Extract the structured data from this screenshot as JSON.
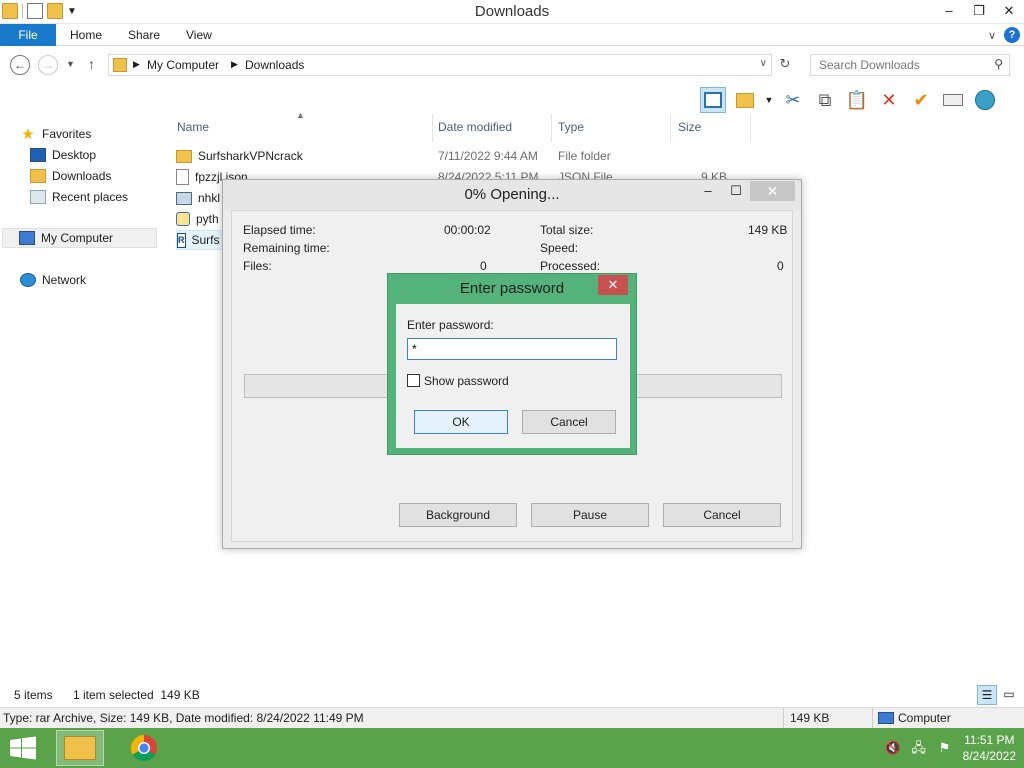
{
  "window": {
    "title": "Downloads"
  },
  "ribbon": {
    "tabs": [
      "File",
      "Home",
      "Share",
      "View"
    ]
  },
  "address": {
    "crumbs": [
      "My Computer",
      "Downloads"
    ],
    "search_placeholder": "Search Downloads"
  },
  "nav": {
    "favorites": "Favorites",
    "favorites_items": [
      "Desktop",
      "Downloads",
      "Recent places"
    ],
    "computer": "My Computer",
    "network": "Network"
  },
  "columns": [
    "Name",
    "Date modified",
    "Type",
    "Size"
  ],
  "files": [
    {
      "name": "SurfsharkVPNcrack",
      "date": "7/11/2022 9:44 AM",
      "type": "File folder",
      "size": "",
      "icon": "folder-icon"
    },
    {
      "name": "fpzzjl.json",
      "date": "8/24/2022 5:11 PM",
      "type": "JSON File",
      "size": "9 KB",
      "icon": "document-icon"
    },
    {
      "name": "nhkl",
      "date": "",
      "type": "",
      "size": "",
      "icon": "image-icon"
    },
    {
      "name": "pyth",
      "date": "",
      "type": "",
      "size": "",
      "icon": "python-icon"
    },
    {
      "name": "Surfs",
      "date": "",
      "type": "",
      "size": "",
      "icon": "rar-archive-icon"
    }
  ],
  "status": {
    "items": "5 items",
    "selected": "1 item selected  149 KB"
  },
  "infobar": {
    "details": "Type: rar Archive, Size: 149 KB, Date modified: 8/24/2022 11:49 PM",
    "size": "149 KB",
    "location": "Computer"
  },
  "progress": {
    "title": "0% Opening...",
    "elapsed_label": "Elapsed time:",
    "elapsed_value": "00:00:02",
    "remaining_label": "Remaining time:",
    "files_label": "Files:",
    "files_value": "0",
    "total_label": "Total size:",
    "total_value": "149 KB",
    "speed_label": "Speed:",
    "processed_label": "Processed:",
    "processed_value": "0",
    "progress_fraction": 0,
    "buttons": {
      "background": "Background",
      "pause": "Pause",
      "cancel": "Cancel"
    }
  },
  "password": {
    "title": "Enter password",
    "label": "Enter password:",
    "value": "*",
    "show_label": "Show password",
    "show_checked": false,
    "ok": "OK",
    "cancel": "Cancel"
  },
  "clock": {
    "time": "11:51 PM",
    "date": "8/24/2022"
  },
  "colors": {
    "accent": "#1979ca",
    "taskbar": "#5aa34a",
    "dialog_frame": "#53b37a",
    "close_red": "#c75050"
  }
}
